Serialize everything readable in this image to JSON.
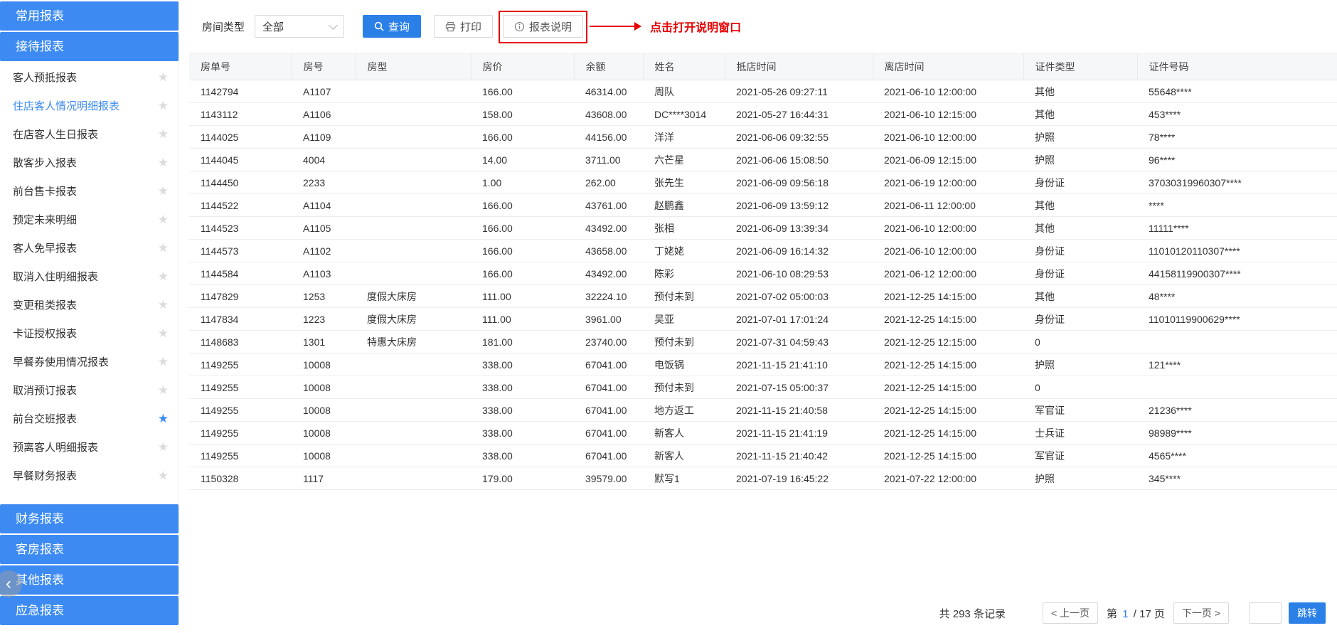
{
  "sidebar": {
    "top_sections": [
      "常用报表",
      "接待报表"
    ],
    "report_items": [
      {
        "label": "客人预抵报表",
        "starred": false,
        "active": false
      },
      {
        "label": "住店客人情况明细报表",
        "starred": false,
        "active": true
      },
      {
        "label": "在店客人生日报表",
        "starred": false,
        "active": false
      },
      {
        "label": "散客步入报表",
        "starred": false,
        "active": false
      },
      {
        "label": "前台售卡报表",
        "starred": false,
        "active": false
      },
      {
        "label": "预定未来明细",
        "starred": false,
        "active": false
      },
      {
        "label": "客人免早报表",
        "starred": false,
        "active": false
      },
      {
        "label": "取消入住明细报表",
        "starred": false,
        "active": false
      },
      {
        "label": "变更租类报表",
        "starred": false,
        "active": false
      },
      {
        "label": "卡证授权报表",
        "starred": false,
        "active": false
      },
      {
        "label": "早餐券使用情况报表",
        "starred": false,
        "active": false
      },
      {
        "label": "取消预订报表",
        "starred": false,
        "active": false
      },
      {
        "label": "前台交班报表",
        "starred": true,
        "active": false
      },
      {
        "label": "预离客人明细报表",
        "starred": false,
        "active": false
      },
      {
        "label": "早餐财务报表",
        "starred": false,
        "active": false
      }
    ],
    "bottom_sections": [
      "财务报表",
      "客房报表",
      "其他报表",
      "应急报表"
    ],
    "collapse_icon": "‹",
    "star_glyph": "★"
  },
  "toolbar": {
    "room_type_label": "房间类型",
    "room_type_value": "全部",
    "query_label": "查询",
    "print_label": "打印",
    "report_info_label": "报表说明",
    "annotation_text": "点击打开说明窗口"
  },
  "table": {
    "columns": [
      "房单号",
      "房号",
      "房型",
      "房价",
      "余额",
      "姓名",
      "抵店时间",
      "离店时间",
      "证件类型",
      "证件号码"
    ],
    "rows": [
      [
        "1142794",
        "A1107",
        "",
        "166.00",
        "46314.00",
        "周队",
        "2021-05-26 09:27:11",
        "2021-06-10 12:00:00",
        "其他",
        "55648****"
      ],
      [
        "1143112",
        "A1106",
        "",
        "158.00",
        "43608.00",
        "DC****3014",
        "2021-05-27 16:44:31",
        "2021-06-10 12:15:00",
        "其他",
        "453****"
      ],
      [
        "1144025",
        "A1109",
        "",
        "166.00",
        "44156.00",
        "洋洋",
        "2021-06-06 09:32:55",
        "2021-06-10 12:00:00",
        "护照",
        "78****"
      ],
      [
        "1144045",
        "4004",
        "",
        "14.00",
        "3711.00",
        "六芒星",
        "2021-06-06 15:08:50",
        "2021-06-09 12:15:00",
        "护照",
        "96****"
      ],
      [
        "1144450",
        "2233",
        "",
        "1.00",
        "262.00",
        "张先生",
        "2021-06-09 09:56:18",
        "2021-06-19 12:00:00",
        "身份证",
        "37030319960307****"
      ],
      [
        "1144522",
        "A1104",
        "",
        "166.00",
        "43761.00",
        "赵鹏鑫",
        "2021-06-09 13:59:12",
        "2021-06-11 12:00:00",
        "其他",
        "****"
      ],
      [
        "1144523",
        "A1105",
        "",
        "166.00",
        "43492.00",
        "张相",
        "2021-06-09 13:39:34",
        "2021-06-10 12:00:00",
        "其他",
        "11111****"
      ],
      [
        "1144573",
        "A1102",
        "",
        "166.00",
        "43658.00",
        "丁姥姥",
        "2021-06-09 16:14:32",
        "2021-06-10 12:00:00",
        "身份证",
        "11010120110307****"
      ],
      [
        "1144584",
        "A1103",
        "",
        "166.00",
        "43492.00",
        "陈彩",
        "2021-06-10 08:29:53",
        "2021-06-12 12:00:00",
        "身份证",
        "44158119900307****"
      ],
      [
        "1147829",
        "1253",
        "度假大床房",
        "111.00",
        "32224.10",
        "预付未到",
        "2021-07-02 05:00:03",
        "2021-12-25 14:15:00",
        "其他",
        "48****"
      ],
      [
        "1147834",
        "1223",
        "度假大床房",
        "111.00",
        "3961.00",
        "吴亚",
        "2021-07-01 17:01:24",
        "2021-12-25 14:15:00",
        "身份证",
        "11010119900629****"
      ],
      [
        "1148683",
        "1301",
        "特惠大床房",
        "181.00",
        "23740.00",
        "预付未到",
        "2021-07-31 04:59:43",
        "2021-12-25 12:15:00",
        "0",
        ""
      ],
      [
        "1149255",
        "10008",
        "",
        "338.00",
        "67041.00",
        "电饭锅",
        "2021-11-15 21:41:10",
        "2021-12-25 14:15:00",
        "护照",
        "121****"
      ],
      [
        "1149255",
        "10008",
        "",
        "338.00",
        "67041.00",
        "预付未到",
        "2021-07-15 05:00:37",
        "2021-12-25 14:15:00",
        "0",
        ""
      ],
      [
        "1149255",
        "10008",
        "",
        "338.00",
        "67041.00",
        "地方返工",
        "2021-11-15 21:40:58",
        "2021-12-25 14:15:00",
        "军官证",
        "21236****"
      ],
      [
        "1149255",
        "10008",
        "",
        "338.00",
        "67041.00",
        "新客人",
        "2021-11-15 21:41:19",
        "2021-12-25 14:15:00",
        "士兵证",
        "98989****"
      ],
      [
        "1149255",
        "10008",
        "",
        "338.00",
        "67041.00",
        "新客人",
        "2021-11-15 21:40:42",
        "2021-12-25 14:15:00",
        "军官证",
        "4565****"
      ],
      [
        "1150328",
        "1117",
        "",
        "179.00",
        "39579.00",
        "默写1",
        "2021-07-19 16:45:22",
        "2021-07-22 12:00:00",
        "护照",
        "345****"
      ]
    ]
  },
  "pagination": {
    "total_text": "共 293 条记录",
    "prev_label": "< 上一页",
    "page_prefix": "第",
    "current_page": "1",
    "page_total_suffix": "/ 17 页",
    "next_label": "下一页 >",
    "jump_input_value": "",
    "jump_label": "跳转"
  },
  "colors": {
    "accent_blue": "#3d8bf2",
    "button_blue": "#2b80e8",
    "annotation_red": "#e60000"
  }
}
